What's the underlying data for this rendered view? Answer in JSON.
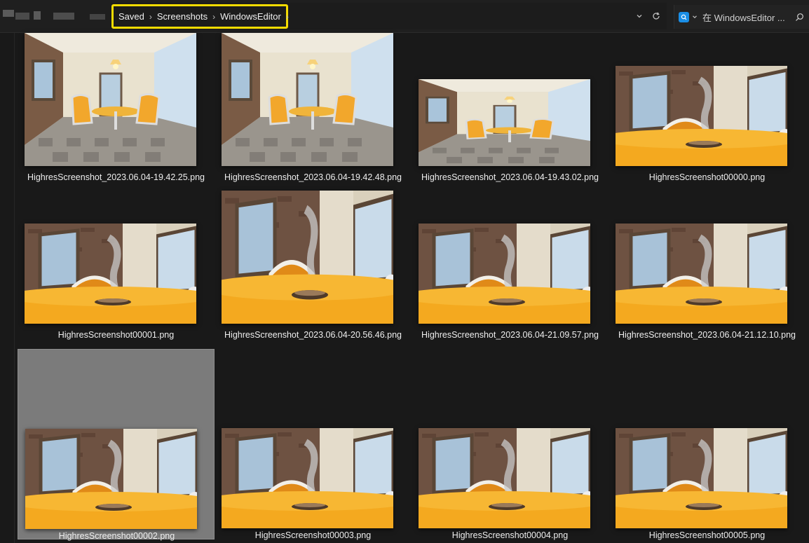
{
  "breadcrumb": [
    "Saved",
    "Screenshots",
    "WindowsEditor"
  ],
  "search": {
    "placeholder": "在 WindowsEditor ..."
  },
  "highlight_color": "#f5dc00",
  "accent_color": "#1a8ee6",
  "files": [
    {
      "name": "HighresScreenshot_2023.06.04-19.42.25.png",
      "scene": "room"
    },
    {
      "name": "HighresScreenshot_2023.06.04-19.42.48.png",
      "scene": "room"
    },
    {
      "name": "HighresScreenshot_2023.06.04-19.43.02.png",
      "scene": "room-wide"
    },
    {
      "name": "HighresScreenshot00000.png",
      "scene": "table"
    },
    {
      "name": "HighresScreenshot00001.png",
      "scene": "table"
    },
    {
      "name": "HighresScreenshot_2023.06.04-20.56.46.png",
      "scene": "table-tall"
    },
    {
      "name": "HighresScreenshot_2023.06.04-21.09.57.png",
      "scene": "table"
    },
    {
      "name": "HighresScreenshot_2023.06.04-21.12.10.png",
      "scene": "table"
    },
    {
      "name": "HighresScreenshot00002.png",
      "scene": "table",
      "selected": true
    },
    {
      "name": "HighresScreenshot00003.png",
      "scene": "table"
    },
    {
      "name": "HighresScreenshot00004.png",
      "scene": "table"
    },
    {
      "name": "HighresScreenshot00005.png",
      "scene": "table"
    }
  ]
}
